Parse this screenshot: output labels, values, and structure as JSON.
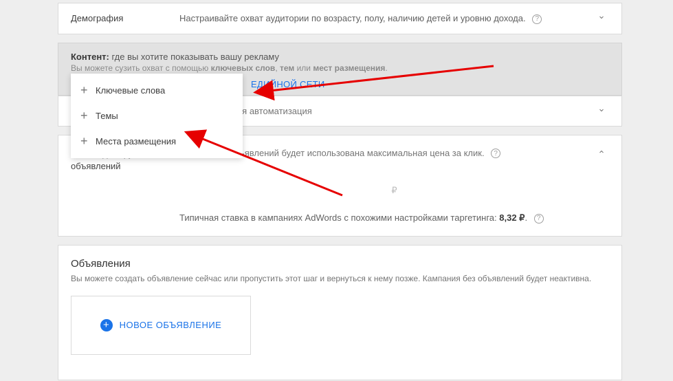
{
  "demography": {
    "label": "Демография",
    "desc": "Настраивайте охват аудитории по возрасту, полу, наличию детей и уровню дохода."
  },
  "content": {
    "title_prefix": "Контент:",
    "title_rest": " где вы хотите показывать вашу рекламу",
    "sub_pre": "Вы можете сузить охват с помощью ",
    "sub_kw": "ключевых слов",
    "sub_sep1": ", ",
    "sub_themes": "тем",
    "sub_sep2": " или ",
    "sub_places": "мест размещения",
    "sub_dot": ".",
    "link_partial": "ЕДИЙНОЙ СЕТИ"
  },
  "popover": {
    "items": [
      "Ключевые слова",
      "Темы",
      "Места размещения"
    ]
  },
  "conservative": {
    "text": "Консервативная автоматизация"
  },
  "bid": {
    "label": "Ставка для группы объявлений",
    "desc": "Для группы объявлений будет использована максимальная цена за клик.",
    "currency": "₽",
    "typical_pre": "Типичная ставка в кампаниях AdWords с похожими настройками таргетинга: ",
    "typical_val": "8,32 ₽",
    "typical_dot": "."
  },
  "ads": {
    "title": "Объявления",
    "desc": "Вы можете создать объявление сейчас или пропустить этот шаг и вернуться к нему позже. Кампания без объявлений будет неактивна.",
    "new_btn": "НОВОЕ ОБЪЯВЛЕНИЕ"
  }
}
